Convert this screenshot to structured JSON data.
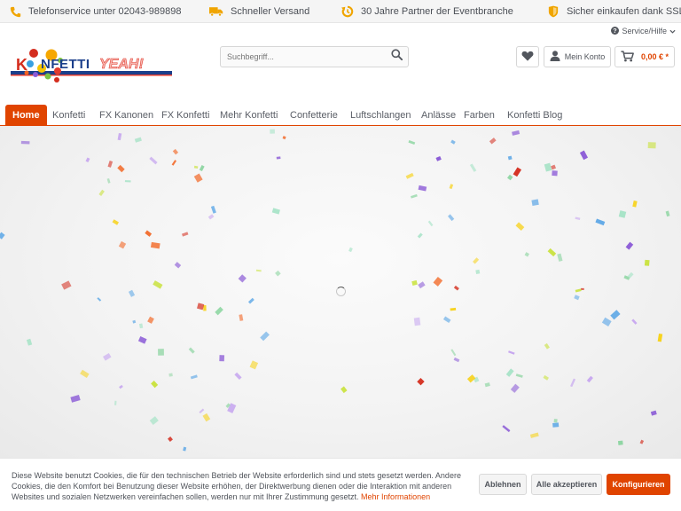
{
  "topbar": {
    "phone": "Telefonservice unter 02043-989898",
    "shipping": "Schneller Versand",
    "partner": "30 Jahre Partner der Eventbranche",
    "ssl": "Sicher einkaufen dank SSL"
  },
  "header": {
    "logo_text": "KONFETTI YEAH!",
    "search_placeholder": "Suchbegriff...",
    "service": "Service/Hilfe",
    "account": "Mein Konto",
    "cart_total": "0,00 € *"
  },
  "nav": {
    "items": [
      "Home",
      "Konfetti",
      "FX Kanonen",
      "FX Konfetti",
      "Mehr Konfetti",
      "Confetterie",
      "Luftschlangen",
      "Anlässe",
      "Farben",
      "Konfetti Blog"
    ],
    "active": "Home"
  },
  "hero": {
    "state": "loading",
    "confetti_colors": [
      "#f7d21b",
      "#c9e23e",
      "#8fd6a3",
      "#a7e3c7",
      "#d42d1e",
      "#f26522",
      "#8b5bd6",
      "#c7a7ef",
      "#5fa8e6"
    ]
  },
  "cookie": {
    "text": "Diese Website benutzt Cookies, die für den technischen Betrieb der Website erforderlich sind und stets gesetzt werden. Andere Cookies, die den Komfort bei Benutzung dieser Website erhöhen, der Direktwerbung dienen oder die Interaktion mit anderen Websites und sozialen Netzwerken vereinfachen sollen, werden nur mit Ihrer Zustimmung gesetzt.",
    "more": "Mehr Informationen",
    "decline": "Ablehnen",
    "accept_all": "Alle akzeptieren",
    "configure": "Konfigurieren"
  },
  "colors": {
    "accent": "#e04400",
    "topbar_icon": "#f0a500"
  }
}
